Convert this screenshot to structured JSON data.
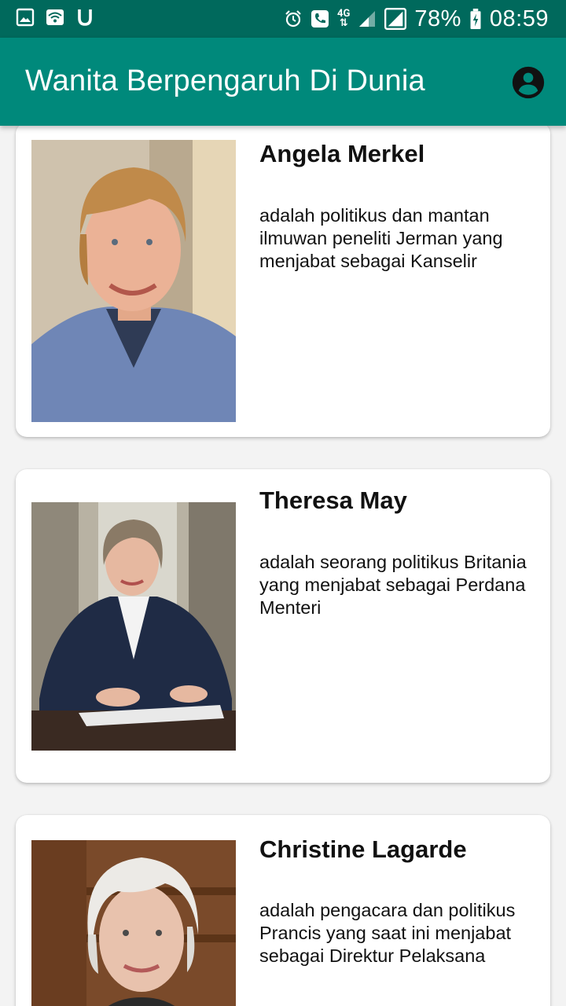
{
  "status_bar": {
    "icons_left": [
      "gallery-icon",
      "wifi-icon",
      "u-icon"
    ],
    "icons_right": [
      "alarm-icon",
      "call-icon",
      "network-4g-icon",
      "signal-icon",
      "signal-box-icon",
      "battery-charging-icon"
    ],
    "network": "4G",
    "battery": "78%",
    "time": "08:59"
  },
  "app_bar": {
    "title": "Wanita Berpengaruh Di Dunia",
    "account_icon": "account-circle-icon"
  },
  "cards": [
    {
      "name": "Angela Merkel",
      "description": "adalah politikus dan mantan ilmuwan peneliti Jerman yang menjabat sebagai Kanselir"
    },
    {
      "name": "Theresa May",
      "description": "adalah seorang politikus Britania yang menjabat sebagai Perdana Menteri"
    },
    {
      "name": "Christine Lagarde",
      "description": "adalah pengacara dan politikus Prancis yang saat ini menjabat sebagai Direktur Pelaksana"
    }
  ],
  "colors": {
    "status_bar": "#00695c",
    "app_bar": "#00897b",
    "background": "#f3f3f3",
    "card": "#ffffff"
  }
}
